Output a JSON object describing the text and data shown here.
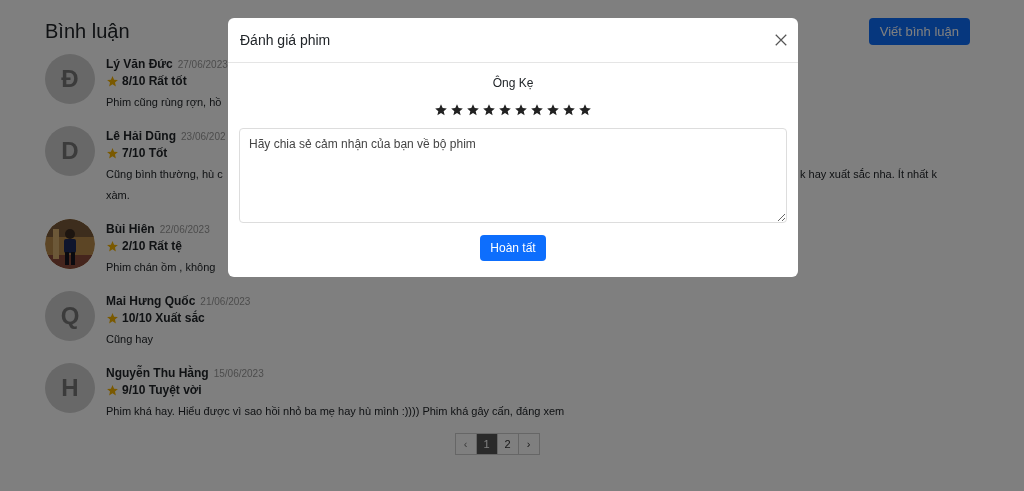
{
  "page": {
    "title": "Bình luận",
    "write_button": "Viết bình luận"
  },
  "comments": [
    {
      "name": "Lý Văn Đức",
      "date": "27/06/2023",
      "avatar": {
        "kind": "letter",
        "letter": "Đ"
      },
      "rating": "8/10 Rất tốt",
      "lines": [
        [
          "Phim cũng rùng rợn, hồ"
        ]
      ]
    },
    {
      "name": "Lê Hải Dũng",
      "date": "23/06/202",
      "avatar": {
        "kind": "letter",
        "letter": "D"
      },
      "rating": "7/10 Tốt",
      "lines": [
        [
          "Cũng bình thường, hù c",
          "k hay xuất sắc nha. Ít nhất k"
        ],
        [
          "xàm."
        ]
      ]
    },
    {
      "name": "Bùi Hiên",
      "date": "22/06/2023",
      "avatar": {
        "kind": "picture"
      },
      "rating": "2/10 Rất tệ",
      "lines": [
        [
          "Phim chán ồm , không"
        ]
      ]
    },
    {
      "name": "Mai Hưng Quốc",
      "date": "21/06/2023",
      "avatar": {
        "kind": "letter",
        "letter": "Q"
      },
      "rating": "10/10 Xuất sắc",
      "lines": [
        [
          "Cũng hay"
        ]
      ]
    },
    {
      "name": "Nguyễn Thu Hằng",
      "date": "15/06/2023",
      "avatar": {
        "kind": "letter",
        "letter": "H"
      },
      "rating": "9/10 Tuyệt vời",
      "lines": [
        [
          "Phim khá hay. Hiểu được vì sao hồi nhỏ ba mẹ hay hù mình :)))) Phim khá gây cấn, đáng xem"
        ]
      ]
    }
  ],
  "pagination": [
    {
      "label": "‹",
      "selected": false,
      "disabled": true
    },
    {
      "label": "1",
      "selected": true,
      "disabled": false
    },
    {
      "label": "2",
      "selected": false,
      "disabled": false
    },
    {
      "label": "›",
      "selected": false,
      "disabled": false
    }
  ],
  "modal": {
    "title": "Đánh giá phim",
    "movie": "Ông Kẹ",
    "stars": 10,
    "placeholder": "Hãy chia sẻ cảm nhận của bạn về bộ phim",
    "submit": "Hoàn tất"
  }
}
